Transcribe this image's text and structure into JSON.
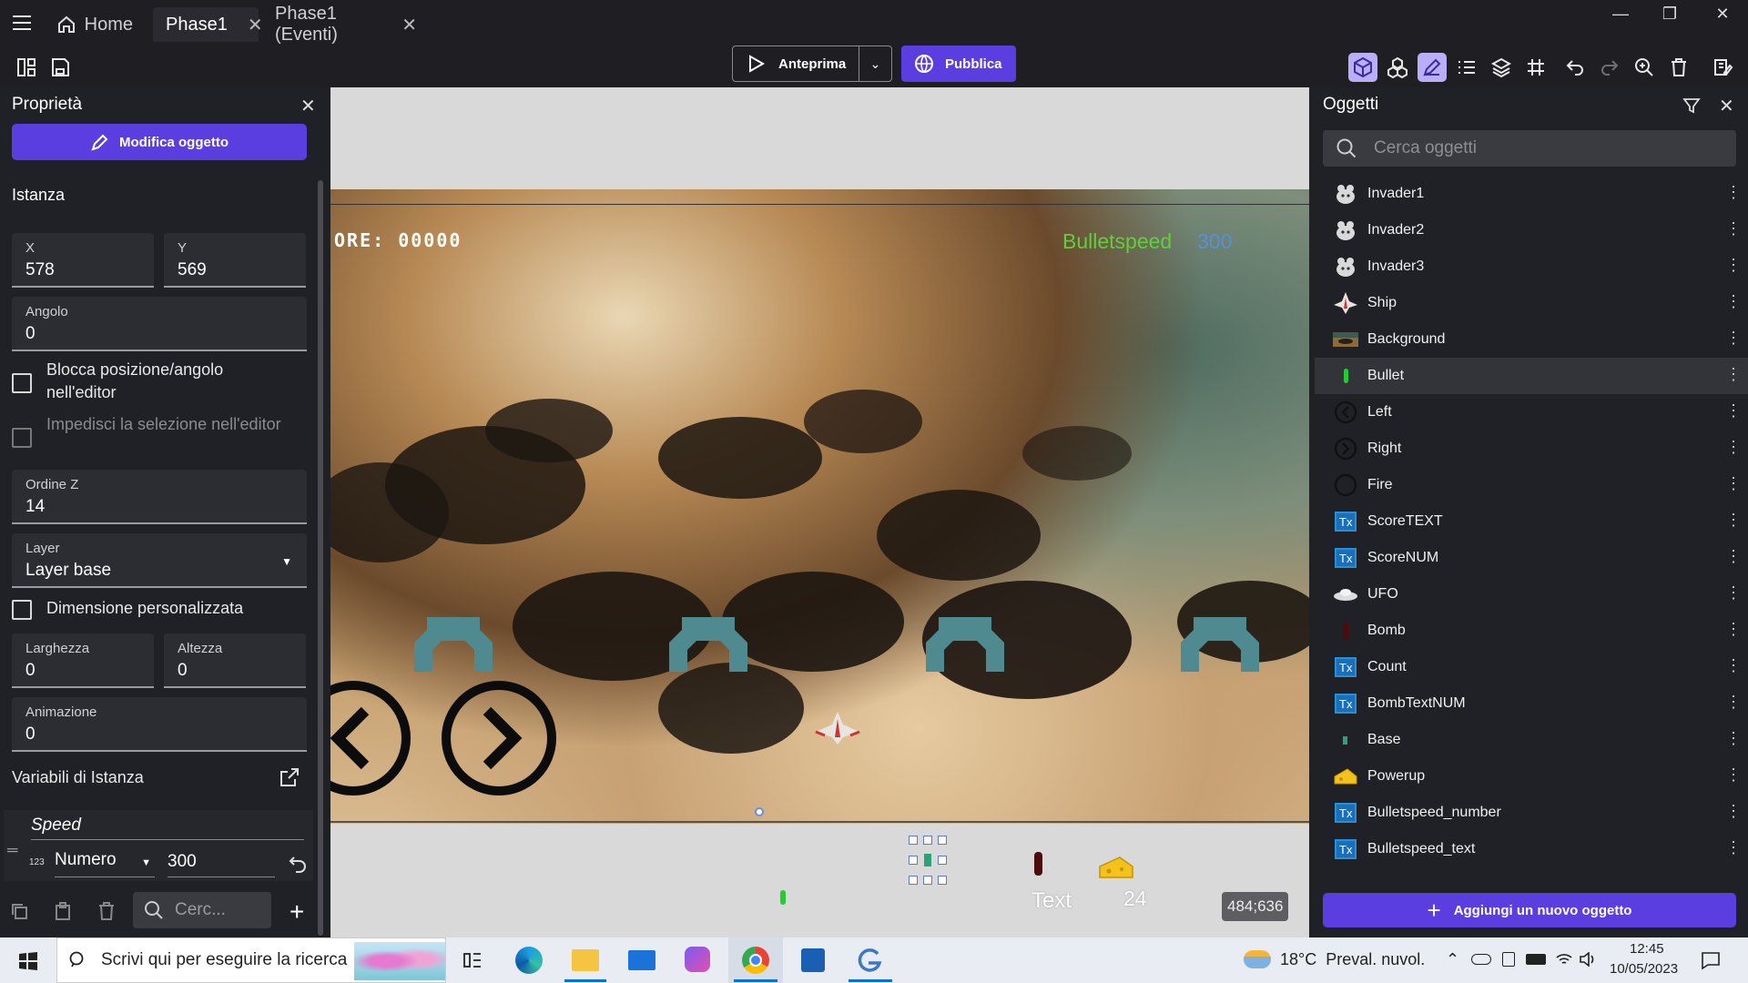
{
  "tabs": [
    {
      "label": "Home"
    },
    {
      "label": "Phase1"
    },
    {
      "label": "Phase1 (Eventi)"
    }
  ],
  "toolbar": {
    "preview_label": "Anteprima",
    "publish_label": "Pubblica"
  },
  "properties": {
    "title": "Proprietà",
    "edit_button": "Modifica oggetto",
    "instance_heading": "Istanza",
    "x": {
      "label": "X",
      "value": "578"
    },
    "y": {
      "label": "Y",
      "value": "569"
    },
    "angle": {
      "label": "Angolo",
      "value": "0"
    },
    "lock_label": "Blocca posizione/angolo nell'editor",
    "prevent_select_label": "Impedisci la selezione nell'editor",
    "zorder": {
      "label": "Ordine Z",
      "value": "14"
    },
    "layer": {
      "label": "Layer",
      "value": "Layer base"
    },
    "custom_size_label": "Dimensione personalizzata",
    "width": {
      "label": "Larghezza",
      "value": "0"
    },
    "height": {
      "label": "Altezza",
      "value": "0"
    },
    "animation": {
      "label": "Animazione",
      "value": "0"
    },
    "instance_vars_label": "Variabili di Istanza",
    "variable": {
      "name": "Speed",
      "type_badge": "123",
      "type": "Numero",
      "value": "300"
    },
    "search_placeholder": "Cerc..."
  },
  "scene": {
    "score_text": "ORE: 00000",
    "bulletspeed_label": "Bulletspeed",
    "bulletspeed_value": "300",
    "text_label": "Text",
    "count_value": "24",
    "coords": "484;636"
  },
  "objects": {
    "title": "Oggetti",
    "search_placeholder": "Cerca oggetti",
    "add_button": "Aggiungi un nuovo oggetto",
    "items": [
      {
        "name": "Invader1",
        "icon": "rat-icon"
      },
      {
        "name": "Invader2",
        "icon": "rat-icon"
      },
      {
        "name": "Invader3",
        "icon": "rat-icon"
      },
      {
        "name": "Ship",
        "icon": "ship-icon"
      },
      {
        "name": "Background",
        "icon": "background-icon"
      },
      {
        "name": "Bullet",
        "icon": "bullet-icon"
      },
      {
        "name": "Left",
        "icon": "left-arrow-icon"
      },
      {
        "name": "Right",
        "icon": "right-arrow-icon"
      },
      {
        "name": "Fire",
        "icon": "circle-icon"
      },
      {
        "name": "ScoreTEXT",
        "icon": "text-object-icon"
      },
      {
        "name": "ScoreNUM",
        "icon": "text-object-icon"
      },
      {
        "name": "UFO",
        "icon": "ufo-icon"
      },
      {
        "name": "Bomb",
        "icon": "bomb-icon"
      },
      {
        "name": "Count",
        "icon": "text-object-icon"
      },
      {
        "name": "BombTextNUM",
        "icon": "text-object-icon"
      },
      {
        "name": "Base",
        "icon": "base-icon"
      },
      {
        "name": "Powerup",
        "icon": "cheese-icon"
      },
      {
        "name": "Bulletspeed_number",
        "icon": "text-object-icon"
      },
      {
        "name": "Bulletspeed_text",
        "icon": "text-object-icon"
      }
    ]
  },
  "taskbar": {
    "search_placeholder": "Scrivi qui per eseguire la ricerca",
    "weather": "18°C  Preval. nuvol.",
    "time": "12:45",
    "date": "10/05/2023"
  },
  "colors": {
    "accent": "#5b3ee0",
    "green_text": "#5fcf3c",
    "blue_text": "#5a8fd8"
  }
}
